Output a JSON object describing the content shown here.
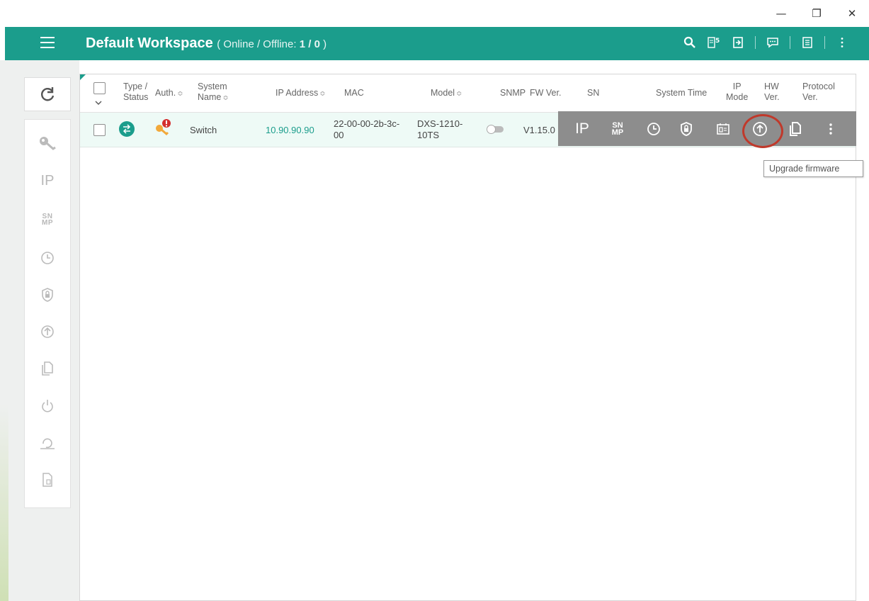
{
  "window": {
    "minimize": "—",
    "restore": "❐",
    "close": "✕"
  },
  "header": {
    "title": "Default Workspace",
    "status_open": "(",
    "status_label": "Online / Offline:",
    "status_value": "1 / 0",
    "status_close": ")",
    "icons": [
      "hamburger-menu-icon",
      "search-icon",
      "discover-icon",
      "import-icon",
      "message-icon",
      "log-icon",
      "more-vertical-icon"
    ]
  },
  "sidebar": {
    "tools": [
      {
        "name": "key-icon",
        "kind": "icon"
      },
      {
        "name": "ip-config",
        "kind": "text",
        "label": "IP"
      },
      {
        "name": "snmp-config",
        "kind": "snmp",
        "line1": "SN",
        "line2": "MP"
      },
      {
        "name": "clock-icon",
        "kind": "icon"
      },
      {
        "name": "shield-lock-icon",
        "kind": "icon"
      },
      {
        "name": "upload-icon",
        "kind": "icon"
      },
      {
        "name": "copy-icon",
        "kind": "icon"
      },
      {
        "name": "power-icon",
        "kind": "icon"
      },
      {
        "name": "reset-icon",
        "kind": "icon"
      },
      {
        "name": "file-delete-icon",
        "kind": "icon"
      }
    ]
  },
  "table": {
    "headers": {
      "type_status_1": "Type /",
      "type_status_2": "Status",
      "auth": "Auth.",
      "system_name_1": "System",
      "system_name_2": "Name",
      "ip_address": "IP Address",
      "mac": "MAC",
      "model": "Model",
      "snmp": "SNMP",
      "fw_ver": "FW Ver.",
      "sn": "SN",
      "system_time": "System Time",
      "ip_mode_1": "IP",
      "ip_mode_2": "Mode",
      "hw_ver_1": "HW",
      "hw_ver_2": "Ver.",
      "protocol_ver_1": "Protocol",
      "protocol_ver_2": "Ver."
    },
    "row": {
      "system_name": "Switch",
      "ip_address": "10.90.90.90",
      "mac_1": "22-00-00-2b-3c-",
      "mac_2": "00",
      "model_1": "DXS-1210-",
      "model_2": "10TS",
      "fw_ver": "V1.15.0",
      "snmp_enabled": false
    },
    "actions": {
      "ip_label": "IP",
      "snmp_1": "SN",
      "snmp_2": "MP"
    }
  },
  "tooltip": {
    "text": "Upgrade firmware"
  },
  "colors": {
    "accent": "#1b9d8c",
    "action_bar": "#8d8d8d",
    "highlight": "#c0392b"
  }
}
